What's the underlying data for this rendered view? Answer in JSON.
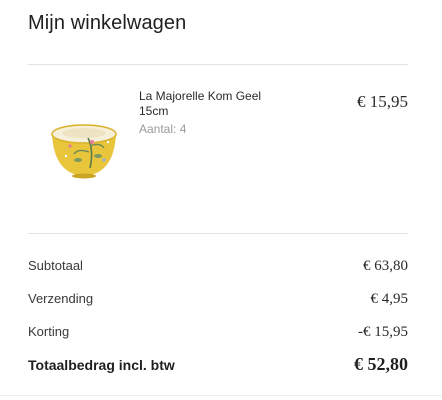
{
  "cart": {
    "title": "Mijn winkelwagen"
  },
  "item": {
    "name": "La Majorelle Kom Geel 15cm",
    "quantity": "Aantal: 4",
    "price": "€ 15,95",
    "image_icon": "yellow-bowl-product-image"
  },
  "summary": {
    "subtotal_label": "Subtotaal",
    "subtotal_value": "€ 63,80",
    "shipping_label": "Verzending",
    "shipping_value": "€ 4,95",
    "discount_label": "Korting",
    "discount_value": "-€ 15,95",
    "total_label": "Totaalbedrag incl. btw",
    "total_value": "€ 52,80"
  },
  "colors": {
    "bowl_yellow": "#e8c53a",
    "bowl_rim": "#d9b22a",
    "bowl_inner": "#f6efd9",
    "divider": "#e2e2e2"
  }
}
